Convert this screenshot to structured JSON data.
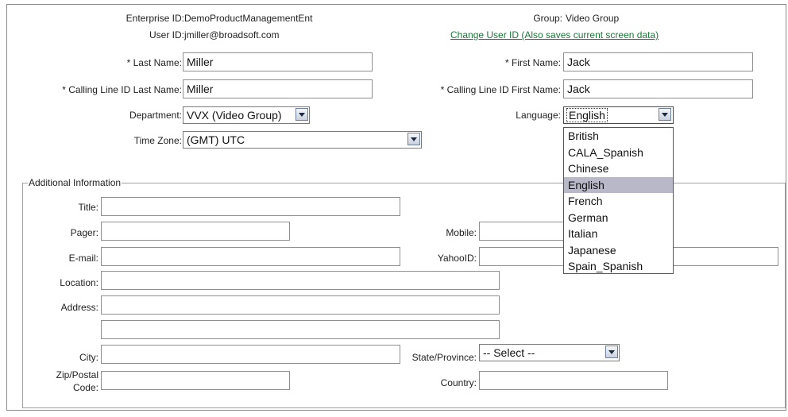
{
  "header": {
    "enterprise_id_label": "Enterprise ID:",
    "enterprise_id_value": "DemoProductManagementEnt",
    "user_id_label": "User ID:",
    "user_id_value": "jmiller@broadsoft.com",
    "group_label": "Group:",
    "group_value": "Video Group",
    "change_user_id_link": "Change User ID (Also saves current screen data)"
  },
  "form": {
    "last_name_label": "* Last Name:",
    "last_name_value": "Miller",
    "first_name_label": "* First Name:",
    "first_name_value": "Jack",
    "cli_last_name_label": "* Calling Line ID Last Name:",
    "cli_last_name_value": "Miller",
    "cli_first_name_label": "* Calling Line ID First Name:",
    "cli_first_name_value": "Jack",
    "department_label": "Department:",
    "department_value": "VVX (Video Group)",
    "language_label": "Language:",
    "language_value": "English",
    "timezone_label": "Time Zone:",
    "timezone_value": "(GMT) UTC"
  },
  "language_dropdown": {
    "options": [
      "British",
      "CALA_Spanish",
      "Chinese",
      "English",
      "French",
      "German",
      "Italian",
      "Japanese",
      "Spain_Spanish"
    ],
    "selected": "English"
  },
  "additional": {
    "legend": "Additional Information",
    "title_label": "Title:",
    "title_value": "",
    "pager_label": "Pager:",
    "pager_value": "",
    "mobile_label": "Mobile:",
    "mobile_value": "",
    "email_label": "E-mail:",
    "email_value": "",
    "yahoo_label": "YahooID:",
    "yahoo_value": "",
    "location_label": "Location:",
    "location_value": "",
    "address_label": "Address:",
    "address_line1_value": "",
    "address_line2_value": "",
    "city_label": "City:",
    "city_value": "",
    "state_label": "State/Province:",
    "state_value": "-- Select --",
    "zip_label_line1": "Zip/Postal",
    "zip_label_line2": "Code:",
    "zip_value": "",
    "country_label": "Country:",
    "country_value": ""
  }
}
